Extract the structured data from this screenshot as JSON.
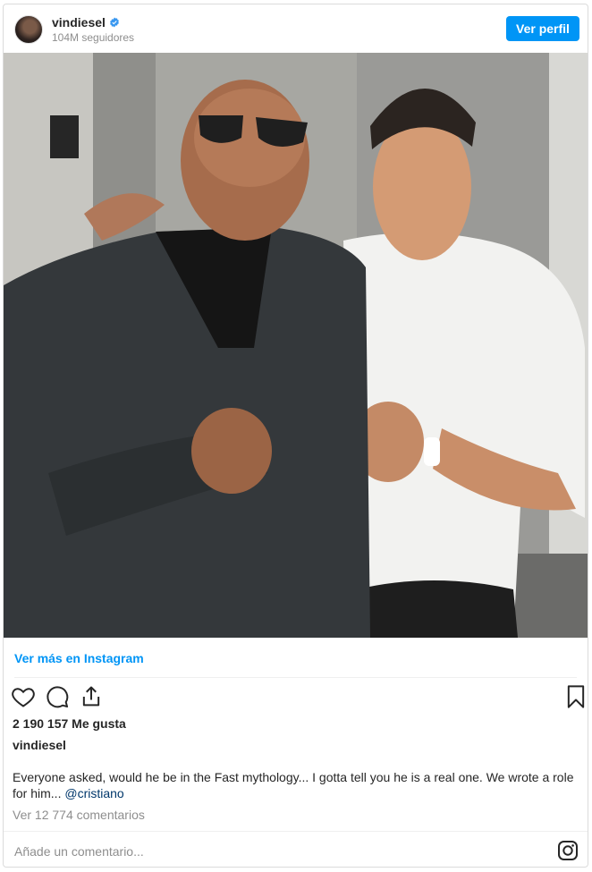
{
  "header": {
    "username": "vindiesel",
    "followers": "104M seguidores",
    "profile_button": "Ver perfil"
  },
  "post": {
    "image_icon": "photo",
    "view_more_link": "Ver más en Instagram",
    "likes": "2 190 157 Me gusta",
    "caption_user": "vindiesel",
    "caption_text": "Everyone asked, would he be in the Fast mythology... I gotta tell you he is a real one. We wrote a role for him... ",
    "caption_mention": "@cristiano",
    "view_comments": "Ver 12 774 comentarios",
    "comment_placeholder": "Añade un comentario..."
  },
  "icons": {
    "verified": "verified-badge-icon",
    "like": "heart-icon",
    "comment": "comment-icon",
    "share": "share-icon",
    "save": "bookmark-icon",
    "instagram": "instagram-logo-icon"
  },
  "colors": {
    "accent": "#0095f6",
    "mention": "#00376b",
    "muted": "#8e8e8e",
    "text": "#262626"
  }
}
